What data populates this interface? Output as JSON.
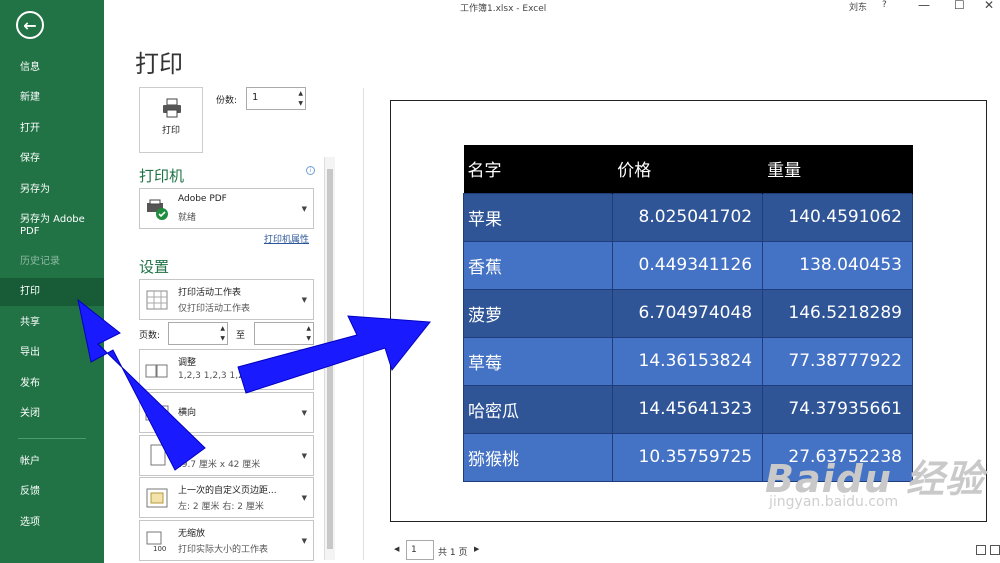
{
  "titlebar": {
    "title": "工作簿1.xlsx  -  Excel",
    "user": "刘东",
    "help": "?",
    "minimize": "—",
    "restore": "☐",
    "close": "✕"
  },
  "sidebar": {
    "back_icon": "left-arrow-icon",
    "items": [
      {
        "label": "信息"
      },
      {
        "label": "新建"
      },
      {
        "label": "打开"
      },
      {
        "label": "保存"
      },
      {
        "label": "另存为"
      },
      {
        "label": "另存为 Adobe PDF"
      },
      {
        "label": "历史记录"
      },
      {
        "label": "打印"
      },
      {
        "label": "共享"
      },
      {
        "label": "导出"
      },
      {
        "label": "发布"
      },
      {
        "label": "关闭"
      },
      {
        "label": "帐户"
      },
      {
        "label": "反馈"
      },
      {
        "label": "选项"
      }
    ],
    "active": "打印"
  },
  "print_panel": {
    "heading": "打印",
    "print_button": "打印",
    "copies_label": "份数:",
    "copies_value": "1",
    "printer_section": "打印机",
    "printer_name": "Adobe PDF",
    "printer_status": "就绪",
    "printer_properties": "打印机属性",
    "settings_section": "设置",
    "scope_title": "打印活动工作表",
    "scope_desc": "仅打印活动工作表",
    "pages_label": "页数:",
    "to_label": "至",
    "collate_title": "调整",
    "collate_desc": "1,2,3    1,2,3    1,2,3",
    "orientation": "横向",
    "paper_size": "29.7 厘米 x 42 厘米",
    "margins_title": "上一次的自定义页边距...",
    "margins_desc": "左: 2 厘米    右: 2 厘米",
    "scaling_title": "无缩放",
    "scaling_desc": "打印实际大小的工作表"
  },
  "preview": {
    "headers": [
      "名字",
      "价格",
      "重量"
    ],
    "rows": [
      [
        "苹果",
        "8.025041702",
        "140.4591062"
      ],
      [
        "香蕉",
        "0.449341126",
        "138.040453"
      ],
      [
        "菠萝",
        "6.704974048",
        "146.5218289"
      ],
      [
        "草莓",
        "14.36153824",
        "77.38777922"
      ],
      [
        "哈密瓜",
        "14.45641323",
        "74.37935661"
      ],
      [
        "猕猴桃",
        "10.35759725",
        "27.63752238"
      ]
    ],
    "colors": {
      "header": "#000000",
      "dark_row": "#2f5597",
      "light_row": "#4472c4"
    }
  },
  "pager": {
    "current_page": "1",
    "total": "共 1 页",
    "prev": "◀",
    "next": "▶"
  },
  "watermark": {
    "logo": "Baidu 经验",
    "url": "jingyan.baidu.com"
  },
  "colors": {
    "accent": "#217346",
    "annotation_arrow": "#1a1aff"
  }
}
